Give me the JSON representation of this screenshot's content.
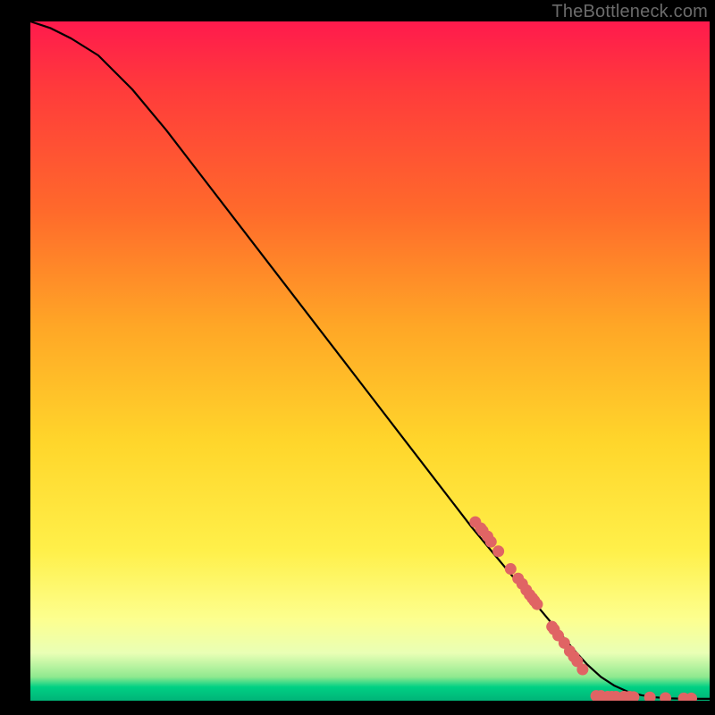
{
  "attribution": "TheBottleneck.com",
  "colors": {
    "curve_stroke": "#000000",
    "dot_fill": "#e06464",
    "dot_stroke": "#c44f4f"
  },
  "chart_data": {
    "type": "line",
    "title": "",
    "xlabel": "",
    "ylabel": "",
    "xlim": [
      0,
      100
    ],
    "ylim": [
      0,
      100
    ],
    "series": [
      {
        "name": "curve",
        "x": [
          0,
          3,
          6,
          10,
          15,
          20,
          25,
          30,
          35,
          40,
          45,
          50,
          55,
          60,
          65,
          70,
          75,
          80,
          82,
          84,
          86,
          88,
          90,
          92,
          94,
          96,
          98,
          100
        ],
        "y": [
          100,
          99,
          97.5,
          95,
          90,
          84,
          77.5,
          71,
          64.5,
          58,
          51.5,
          45,
          38.5,
          32,
          25.5,
          19.5,
          13.5,
          7.5,
          5.3,
          3.5,
          2.2,
          1.3,
          0.8,
          0.5,
          0.35,
          0.3,
          0.28,
          0.28
        ]
      }
    ],
    "dots": [
      {
        "x": 65.5,
        "y": 26.3
      },
      {
        "x": 66.3,
        "y": 25.4
      },
      {
        "x": 66.6,
        "y": 25.0
      },
      {
        "x": 67.3,
        "y": 24.2
      },
      {
        "x": 67.8,
        "y": 23.4
      },
      {
        "x": 68.9,
        "y": 22.0
      },
      {
        "x": 70.7,
        "y": 19.4
      },
      {
        "x": 71.8,
        "y": 18.0
      },
      {
        "x": 72.4,
        "y": 17.2
      },
      {
        "x": 73.0,
        "y": 16.3
      },
      {
        "x": 73.5,
        "y": 15.6
      },
      {
        "x": 73.9,
        "y": 15.1
      },
      {
        "x": 74.2,
        "y": 14.7
      },
      {
        "x": 74.6,
        "y": 14.2
      },
      {
        "x": 76.8,
        "y": 10.9
      },
      {
        "x": 77.1,
        "y": 10.5
      },
      {
        "x": 77.7,
        "y": 9.6
      },
      {
        "x": 78.6,
        "y": 8.5
      },
      {
        "x": 79.4,
        "y": 7.3
      },
      {
        "x": 80.0,
        "y": 6.5
      },
      {
        "x": 80.5,
        "y": 5.8
      },
      {
        "x": 81.3,
        "y": 4.6
      },
      {
        "x": 83.3,
        "y": 0.7
      },
      {
        "x": 84.0,
        "y": 0.7
      },
      {
        "x": 85.0,
        "y": 0.6
      },
      {
        "x": 85.6,
        "y": 0.6
      },
      {
        "x": 86.2,
        "y": 0.6
      },
      {
        "x": 87.4,
        "y": 0.6
      },
      {
        "x": 88.2,
        "y": 0.6
      },
      {
        "x": 88.8,
        "y": 0.55
      },
      {
        "x": 91.2,
        "y": 0.5
      },
      {
        "x": 93.5,
        "y": 0.4
      },
      {
        "x": 96.2,
        "y": 0.35
      },
      {
        "x": 97.3,
        "y": 0.35
      }
    ],
    "dot_radius_px": 6.5
  }
}
